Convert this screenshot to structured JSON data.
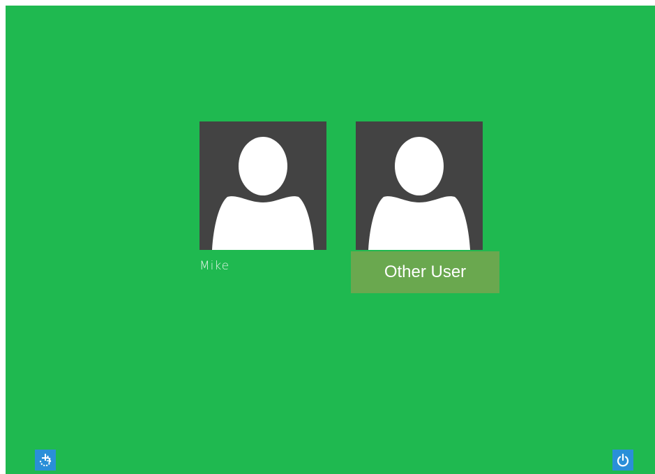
{
  "users": [
    {
      "name": "Mike",
      "avatar_icon": "user-silhouette-icon"
    },
    {
      "name": "Other User",
      "avatar_icon": "user-silhouette-icon"
    }
  ],
  "bottom_bar": {
    "left_icon": "ease-of-access-icon",
    "right_icon": "power-icon"
  },
  "colors": {
    "background": "#1fb950",
    "tile": "#434343",
    "selected_label": "#6aa84f",
    "corner_button": "#2a8fd8"
  }
}
